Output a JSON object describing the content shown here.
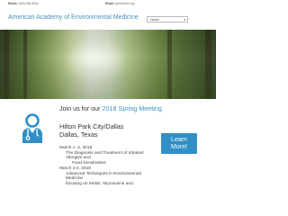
{
  "topbar": {
    "phone_label": "Phone:",
    "phone_value": "(316) 684-5500",
    "email_label": "Email:",
    "email_value": "aaemonline.org"
  },
  "header": {
    "site_title": "American Academy of Environmental Medicine",
    "nav_select_value": "Home"
  },
  "hero": {
    "icon": "forest-background-image"
  },
  "event": {
    "join_prefix": "Join us for our",
    "join_highlight": "2018 Spring Meeting",
    "venue_line1": "Hilton Park City/Dallas",
    "venue_line2": "Dallas, Texas",
    "learn_more_line1": "Learn",
    "learn_more_line2": "More!",
    "icon": "doctor-stethoscope-icon",
    "schedule": [
      {
        "date": "March 1 -2, 2018",
        "lines": [
          "The Diagnosis and Treatment of Inhalant",
          "Allergies and",
          "Food Sensitivities"
        ]
      },
      {
        "date": "March 3-4, 2018",
        "lines": [
          "Advanced Techniques in Environmental",
          "Medicine",
          "focusing on Molds, Mycotoxins and"
        ]
      }
    ]
  },
  "colors": {
    "accent": "#3b93c4",
    "button": "#2f8fc6",
    "title": "#4a8eb0"
  }
}
